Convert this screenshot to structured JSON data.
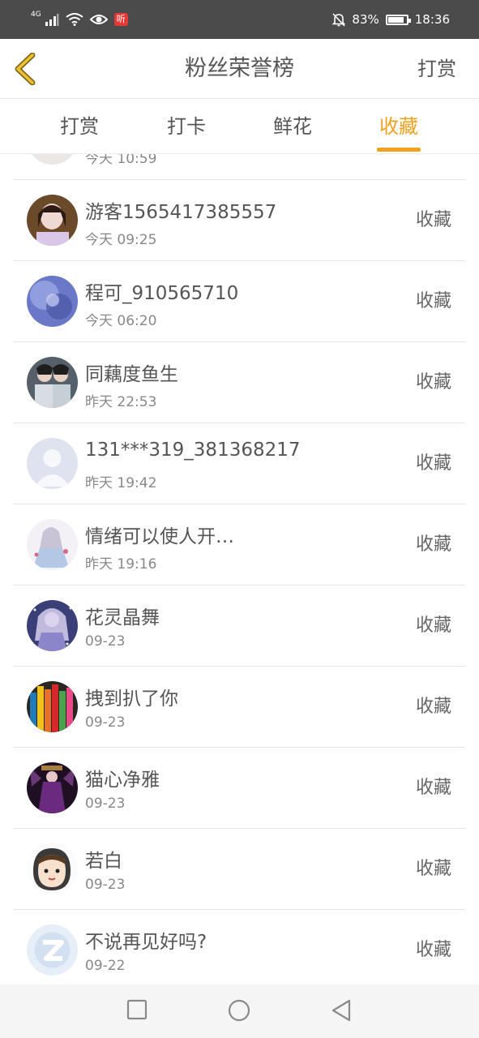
{
  "status_bar": {
    "network": "4G",
    "app_badge": "听",
    "battery": "83%",
    "time": "18:36"
  },
  "header": {
    "title": "粉丝荣誉榜",
    "action_label": "打赏"
  },
  "tabs": [
    {
      "label": "打赏",
      "active": false
    },
    {
      "label": "打卡",
      "active": false
    },
    {
      "label": "鲜花",
      "active": false
    },
    {
      "label": "收藏",
      "active": true
    }
  ],
  "list": {
    "items": [
      {
        "name": "",
        "time": "今天 10:59",
        "action": ""
      },
      {
        "name": "游客1565417385557",
        "time": "今天 09:25",
        "action": "收藏"
      },
      {
        "name": "程可_910565710",
        "time": "今天 06:20",
        "action": "收藏"
      },
      {
        "name": "同藕度鱼生",
        "time": "昨天 22:53",
        "action": "收藏"
      },
      {
        "name": "131***319_381368217",
        "time": "昨天 19:42",
        "action": "收藏"
      },
      {
        "name": "情绪可以使人开…",
        "time": "昨天 19:16",
        "action": "收藏"
      },
      {
        "name": "花灵晶舞",
        "time": "09-23",
        "action": "收藏"
      },
      {
        "name": "拽到扒了你",
        "time": "09-23",
        "action": "收藏"
      },
      {
        "name": "猫心净雅",
        "time": "09-23",
        "action": "收藏"
      },
      {
        "name": "若白",
        "time": "09-23",
        "action": "收藏"
      },
      {
        "name": "不说再见好吗?",
        "time": "09-22",
        "action": "收藏"
      }
    ]
  },
  "colors": {
    "accent": "#f2a11f",
    "status_bar_bg": "#4b4b4b"
  }
}
